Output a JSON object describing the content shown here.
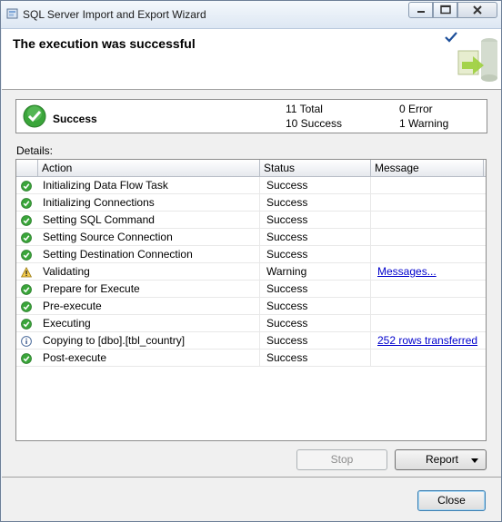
{
  "window": {
    "title": "SQL Server Import and Export Wizard",
    "app_icon": "wizard-app-icon"
  },
  "header": {
    "title": "The execution was successful"
  },
  "summary": {
    "status": "Success",
    "total": "11 Total",
    "success": "10 Success",
    "error": "0 Error",
    "warning": "1 Warning"
  },
  "details_label": "Details:",
  "table": {
    "columns": [
      "Action",
      "Status",
      "Message"
    ],
    "rows": [
      {
        "icon": "success-icon",
        "action": "Initializing Data Flow Task",
        "status": "Success",
        "message": ""
      },
      {
        "icon": "success-icon",
        "action": "Initializing Connections",
        "status": "Success",
        "message": ""
      },
      {
        "icon": "success-icon",
        "action": "Setting SQL Command",
        "status": "Success",
        "message": ""
      },
      {
        "icon": "success-icon",
        "action": "Setting Source Connection",
        "status": "Success",
        "message": ""
      },
      {
        "icon": "success-icon",
        "action": "Setting Destination Connection",
        "status": "Success",
        "message": ""
      },
      {
        "icon": "warning-icon",
        "action": "Validating",
        "status": "Warning",
        "message": "Messages..."
      },
      {
        "icon": "success-icon",
        "action": "Prepare for Execute",
        "status": "Success",
        "message": ""
      },
      {
        "icon": "success-icon",
        "action": "Pre-execute",
        "status": "Success",
        "message": ""
      },
      {
        "icon": "success-icon",
        "action": "Executing",
        "status": "Success",
        "message": ""
      },
      {
        "icon": "info-icon",
        "action": "Copying to [dbo].[tbl_country]",
        "status": "Success",
        "message": "252 rows transferred"
      },
      {
        "icon": "success-icon",
        "action": "Post-execute",
        "status": "Success",
        "message": ""
      }
    ]
  },
  "buttons": {
    "stop": "Stop",
    "report": "Report",
    "close": "Close"
  },
  "colors": {
    "success_green": "#3aa53a",
    "warning_yellow": "#f2c94c",
    "link_blue": "#0000cc"
  }
}
